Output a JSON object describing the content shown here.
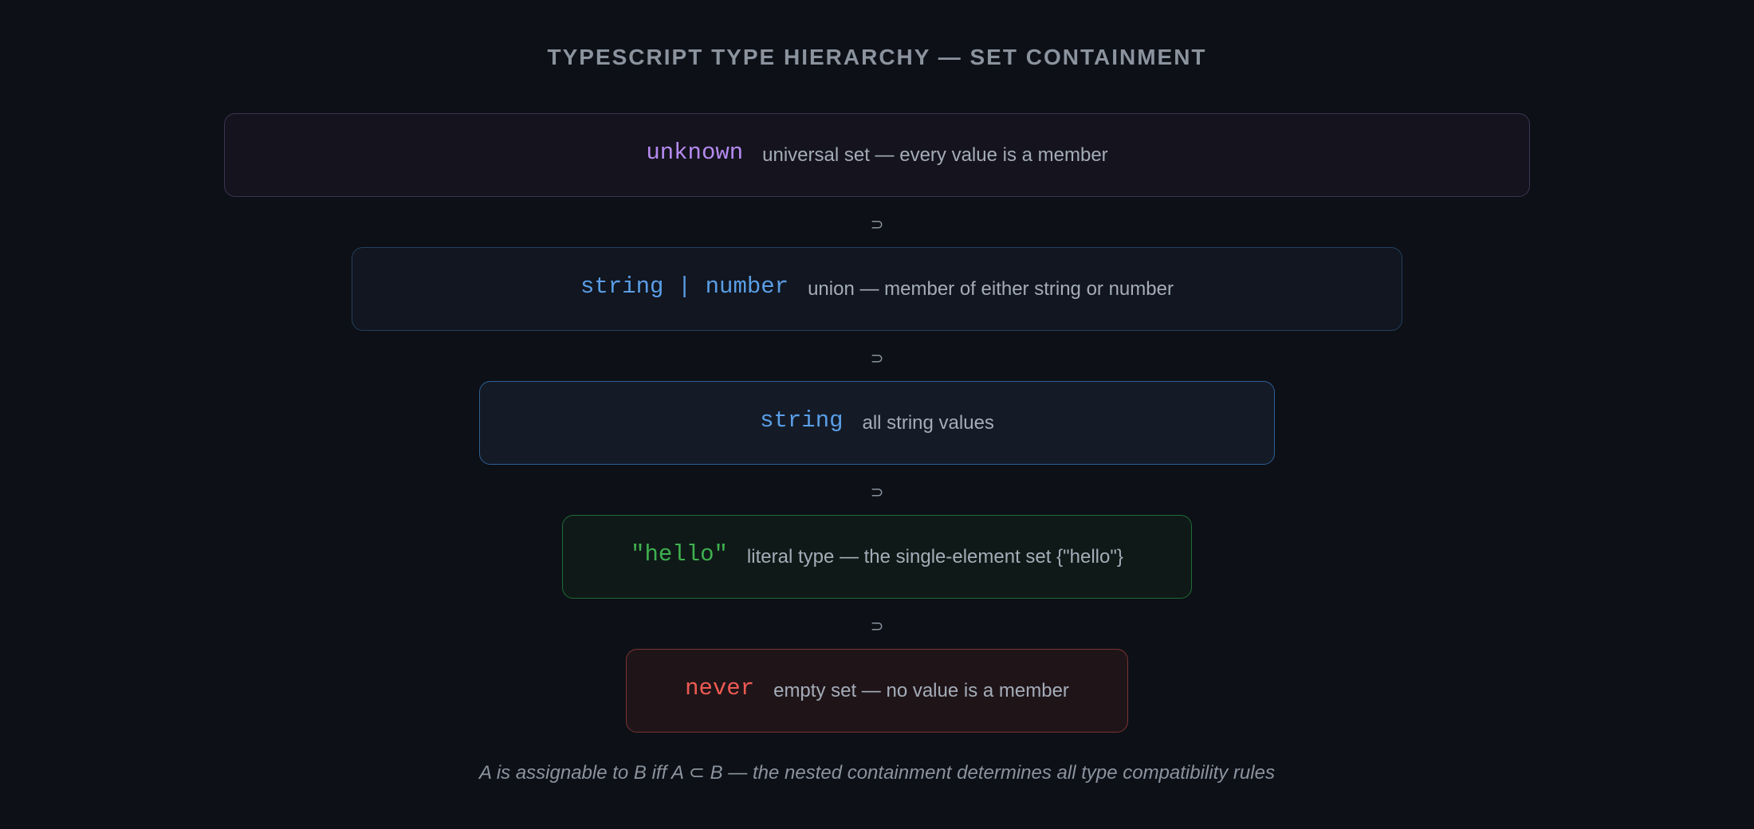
{
  "title": "TYPESCRIPT TYPE HIERARCHY — SET CONTAINMENT",
  "containment_symbol": "⊃",
  "levels": [
    {
      "type": "unknown",
      "description": "universal set — every value is a member",
      "color": "#b58af0"
    },
    {
      "type": "string | number",
      "description": "union — member of either string or number",
      "color": "#5a9ee6"
    },
    {
      "type": "string",
      "description": "all string values",
      "color": "#5a9ee6"
    },
    {
      "type": "\"hello\"",
      "description": "literal type — the single-element set {\"hello\"}",
      "color": "#3fb04f"
    },
    {
      "type": "never",
      "description": "empty set — no value is a member",
      "color": "#ee5a52"
    }
  ],
  "footer": "A is assignable to B iff A ⊂ B — the nested containment determines all type compatibility rules"
}
